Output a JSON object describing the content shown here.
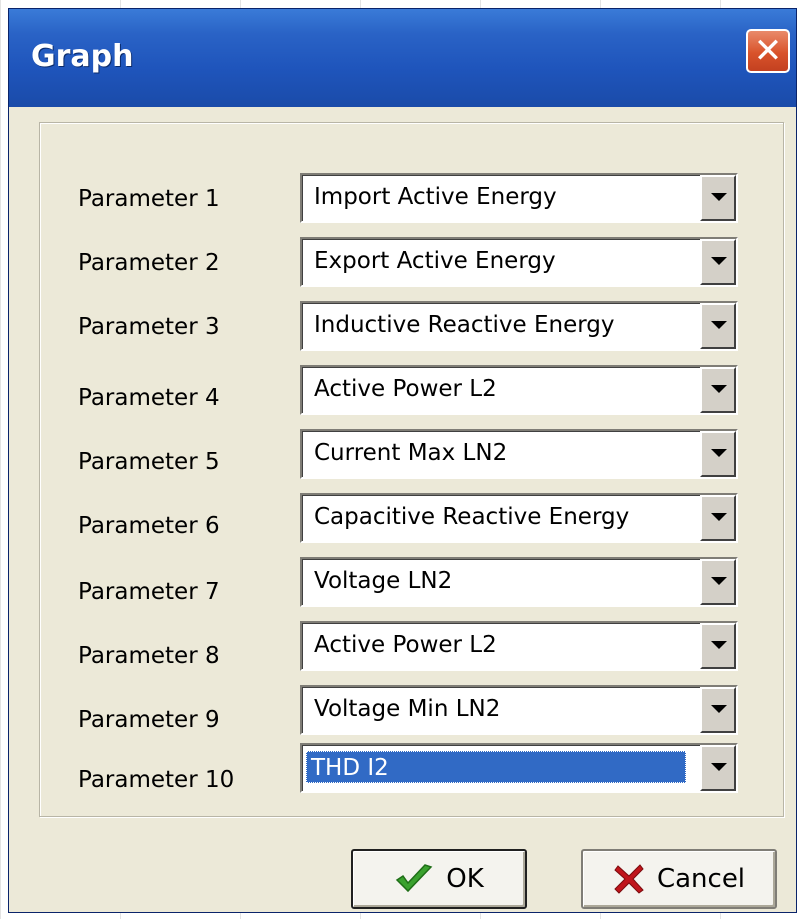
{
  "dialog": {
    "title": "Graph",
    "close_icon": "close-icon"
  },
  "parameters": [
    {
      "label": "Parameter 1",
      "value": "Import Active Energy"
    },
    {
      "label": "Parameter 2",
      "value": "Export Active Energy"
    },
    {
      "label": "Parameter 3",
      "value": "Inductive Reactive Energy"
    },
    {
      "label": "Parameter 4",
      "value": "Active Power L2"
    },
    {
      "label": "Parameter 5",
      "value": "Current Max LN2"
    },
    {
      "label": "Parameter 6",
      "value": "Capacitive Reactive Energy"
    },
    {
      "label": "Parameter 7",
      "value": "Voltage LN2"
    },
    {
      "label": "Parameter 8",
      "value": "Active Power L2"
    },
    {
      "label": "Parameter 9",
      "value": "Voltage Min LN2"
    },
    {
      "label": "Parameter 10",
      "value": "THD I2"
    }
  ],
  "buttons": {
    "ok_label": "OK",
    "ok_icon": "checkmark-icon",
    "cancel_label": "Cancel",
    "cancel_icon": "red-x-icon"
  },
  "colors": {
    "titlebar": "#2a63c6",
    "selection": "#316ac5",
    "dialog_bg": "#ece9d8"
  }
}
